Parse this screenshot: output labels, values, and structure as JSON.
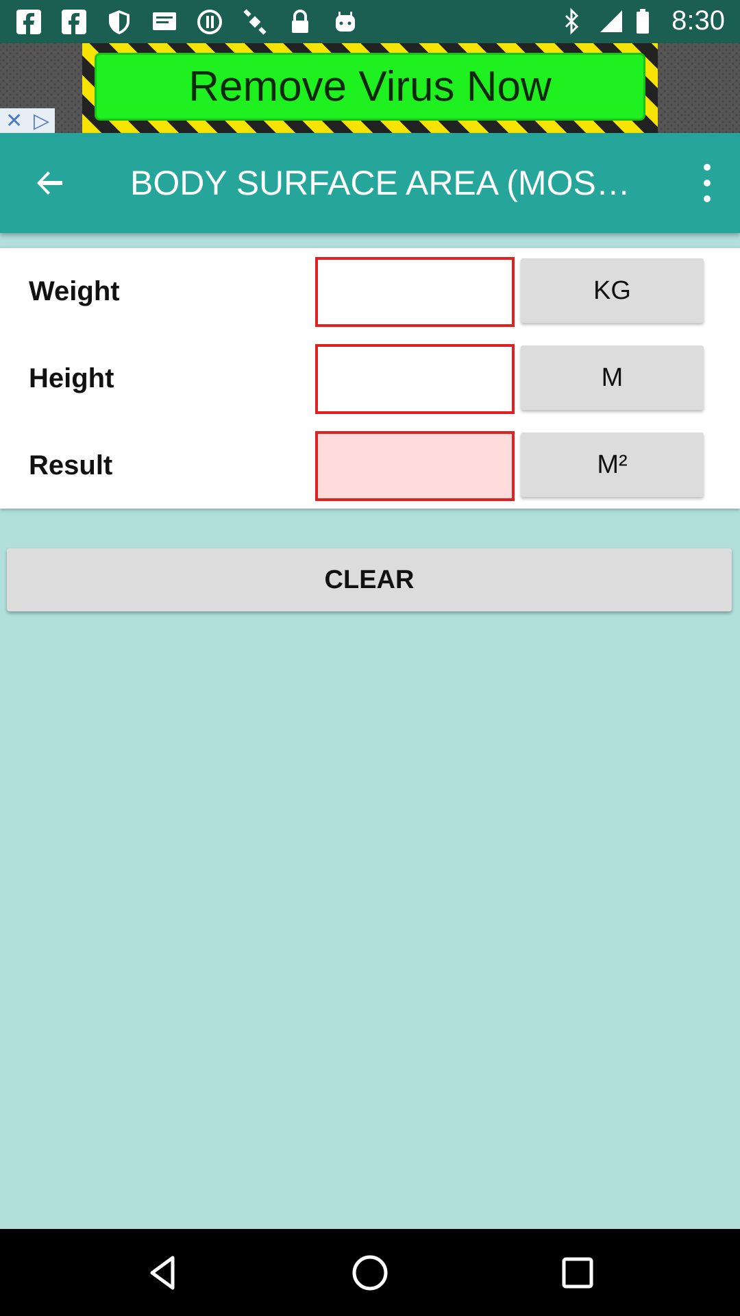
{
  "status_bar": {
    "time": "8:30",
    "left_icons": [
      "facebook-icon",
      "facebook-icon",
      "shield-icon",
      "message-icon",
      "alert-circle-icon",
      "satellite-icon",
      "lock-icon",
      "android-icon"
    ],
    "right_icons": [
      "bluetooth-icon",
      "signal-icon",
      "battery-icon"
    ]
  },
  "ad": {
    "banner_text": "Remove Virus Now"
  },
  "app_bar": {
    "title": "BODY SURFACE AREA (MOSTE…"
  },
  "form": {
    "rows": [
      {
        "label": "Weight",
        "value": "",
        "unit": "KG"
      },
      {
        "label": "Height",
        "value": "",
        "unit": "M"
      },
      {
        "label": "Result",
        "value": "",
        "unit": "M²"
      }
    ]
  },
  "actions": {
    "clear_label": "CLEAR"
  },
  "colors": {
    "status_bar": "#1b5e52",
    "app_bar": "#26a69a",
    "background": "#b2dfdb",
    "input_border": "#e0211f",
    "result_fill": "#ffdcdc"
  }
}
